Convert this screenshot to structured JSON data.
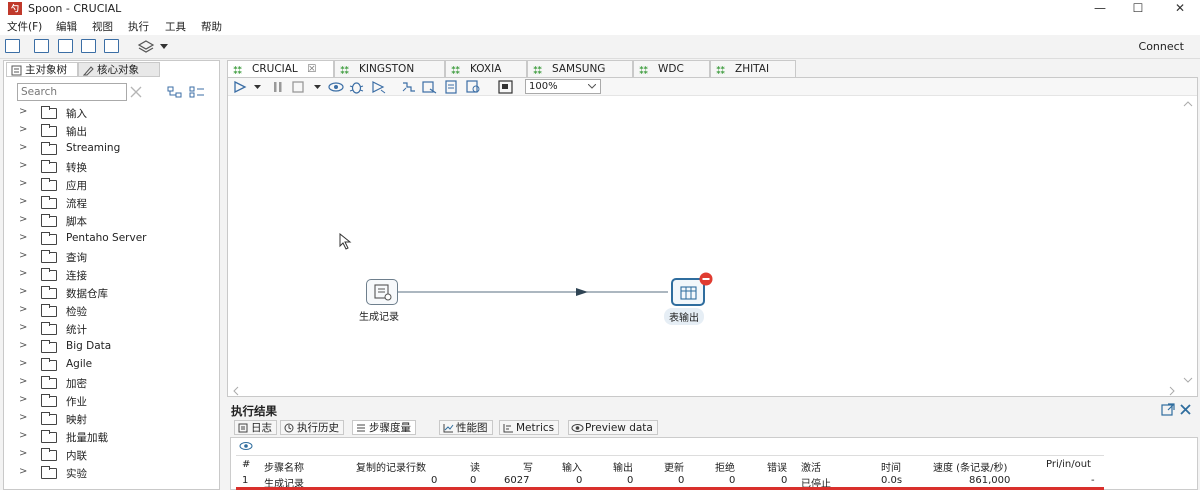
{
  "window": {
    "logo_text": "勺",
    "title": "Spoon - CRUCIAL",
    "minimize": "—",
    "maximize": "☐",
    "close": "✕"
  },
  "menu": [
    "文件(F)",
    "编辑",
    "视图",
    "执行",
    "工具",
    "帮助"
  ],
  "toolbar": {
    "connect_label": "Connect"
  },
  "left_panel": {
    "tabs": [
      "主对象树",
      "核心对象"
    ],
    "search_placeholder": "Search",
    "tree": [
      "输入",
      "输出",
      "Streaming",
      "转换",
      "应用",
      "流程",
      "脚本",
      "Pentaho Server",
      "查询",
      "连接",
      "数据仓库",
      "检验",
      "统计",
      "Big Data",
      "Agile",
      "加密",
      "作业",
      "映射",
      "批量加载",
      "内联",
      "实验"
    ]
  },
  "main_tabs": [
    {
      "label": "CRUCIAL",
      "active": true,
      "close": "☒"
    },
    {
      "label": "KINGSTON"
    },
    {
      "label": "KOXIA"
    },
    {
      "label": "SAMSUNG"
    },
    {
      "label": "WDC"
    },
    {
      "label": "ZHITAI"
    }
  ],
  "canvas": {
    "zoom": "100%",
    "steps": [
      {
        "name": "生成记录"
      },
      {
        "name": "表输出"
      }
    ]
  },
  "results": {
    "title": "执行结果",
    "tabs": [
      "日志",
      "执行历史",
      "步骤度量",
      "性能图",
      "Metrics",
      "Preview data"
    ],
    "columns": [
      "#",
      "步骤名称",
      "复制的记录行数",
      "读",
      "写",
      "输入",
      "输出",
      "更新",
      "拒绝",
      "错误",
      "激活",
      "时间",
      "速度 (条记录/秒)",
      "Pri/in/out"
    ],
    "rows": [
      [
        "1",
        "生成记录",
        "0",
        "0",
        "6027",
        "0",
        "0",
        "0",
        "0",
        "0",
        "已停止",
        "0.0s",
        "861,000",
        "-"
      ]
    ]
  }
}
